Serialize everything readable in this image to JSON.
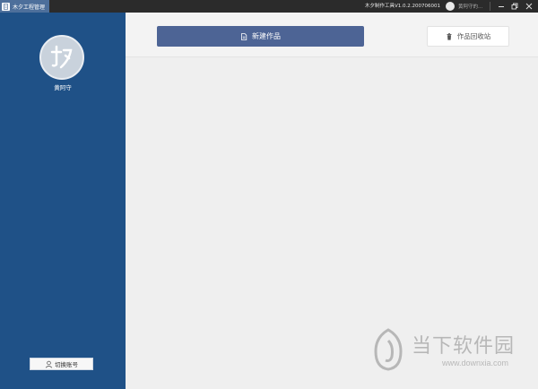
{
  "titlebar": {
    "app_name": "木夕工程管理",
    "version": "木夕制作工具V1.0.2.200706001",
    "user_short": "黄阿守的..."
  },
  "sidebar": {
    "username": "黄阿守",
    "switch_account": "切换账号"
  },
  "toolbar": {
    "new_work": "新建作品",
    "recycle_bin": "作品回收站"
  },
  "watermark": {
    "title": "当下软件园",
    "url": "www.downxia.com"
  },
  "colors": {
    "sidebar": "#1f5187",
    "primary_button": "#4d6495",
    "titlebar": "#2b2b2b",
    "background": "#efefef"
  }
}
